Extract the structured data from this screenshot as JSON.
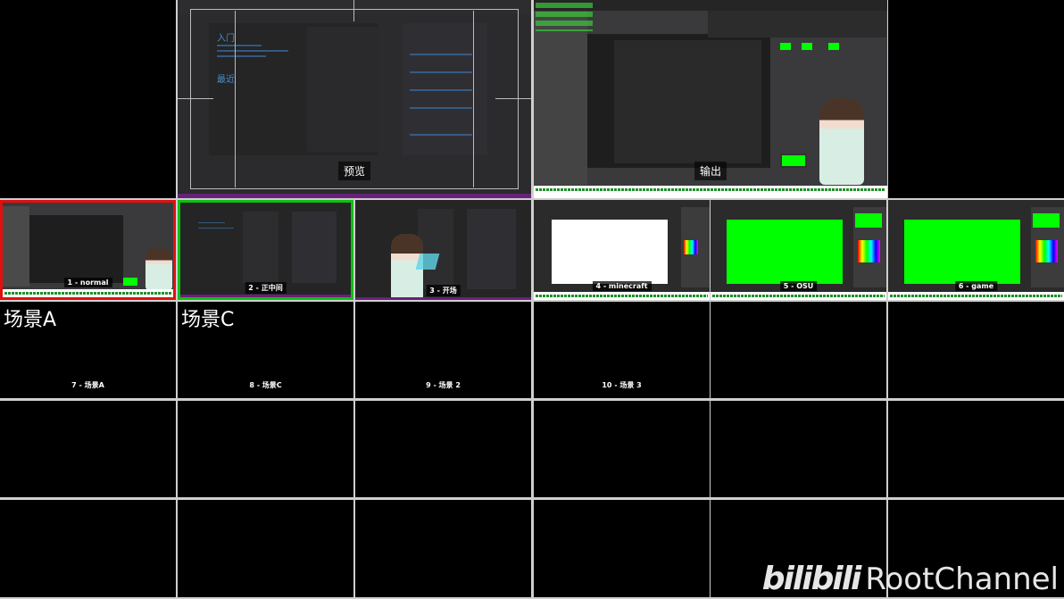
{
  "multiview": {
    "preview": {
      "label": "预览"
    },
    "program": {
      "label": "输出"
    },
    "scenes": [
      {
        "label": "1 - normal",
        "state": "program",
        "border_color": "#e01010"
      },
      {
        "label": "2 - 正中间",
        "state": "preview",
        "border_color": "#10c010"
      },
      {
        "label": "3 - 开场"
      },
      {
        "label": "4 - minecraft"
      },
      {
        "label": "5 - OSU"
      },
      {
        "label": "6 - game"
      },
      {
        "label": "7 - 场景A",
        "overlay_text": "场景A"
      },
      {
        "label": "8 - 场景C",
        "overlay_text": "场景C"
      },
      {
        "label": "9 - 场景 2"
      },
      {
        "label": "10 - 场景 3"
      }
    ]
  },
  "watermark": {
    "logo": "bilibili",
    "channel": "RootChannel"
  },
  "colors": {
    "program": "#e01010",
    "preview": "#10c010",
    "greenscreen": "#00ff00",
    "ticker": "#1f8f2a",
    "vs_purple": "#68217a"
  }
}
